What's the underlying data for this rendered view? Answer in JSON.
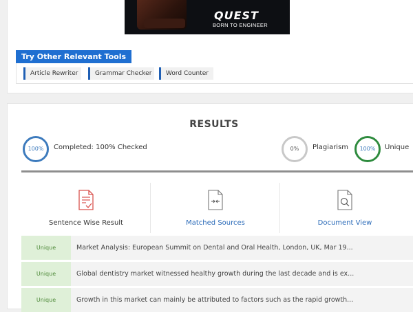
{
  "banner": {
    "brand": "QUEST",
    "tagline": "BORN TO ENGINEER"
  },
  "tools": {
    "title": "Try Other Relevant Tools",
    "items": [
      "Article Rewriter",
      "Grammar Checker",
      "Word Counter"
    ]
  },
  "results": {
    "title": "RESULTS",
    "completed_percent": "100%",
    "completed_label": "Completed: 100% Checked",
    "plagiarism_percent": "0%",
    "plagiarism_label": "Plagiarism",
    "unique_percent": "100%",
    "unique_label": "Unique",
    "progress": 1.0,
    "tabs": [
      {
        "label": "Sentence Wise Result",
        "icon": "document-check-icon"
      },
      {
        "label": "Matched Sources",
        "icon": "document-compare-icon"
      },
      {
        "label": "Document View",
        "icon": "document-search-icon"
      }
    ],
    "rows": [
      {
        "badge": "Unique",
        "text": "Market Analysis: European Summit on Dental and Oral Health, London, UK, Mar 19..."
      },
      {
        "badge": "Unique",
        "text": "Global dentistry market witnessed healthy growth during the last decade and is ex..."
      },
      {
        "badge": "Unique",
        "text": "Growth in this market can mainly be attributed to factors such as the rapid growth..."
      }
    ]
  },
  "colors": {
    "accent": "#1f6fd1",
    "complete_ring": "#3d7bbd",
    "unique_ring": "#2e8b3e",
    "unique_badge_bg": "#dff0d8"
  }
}
